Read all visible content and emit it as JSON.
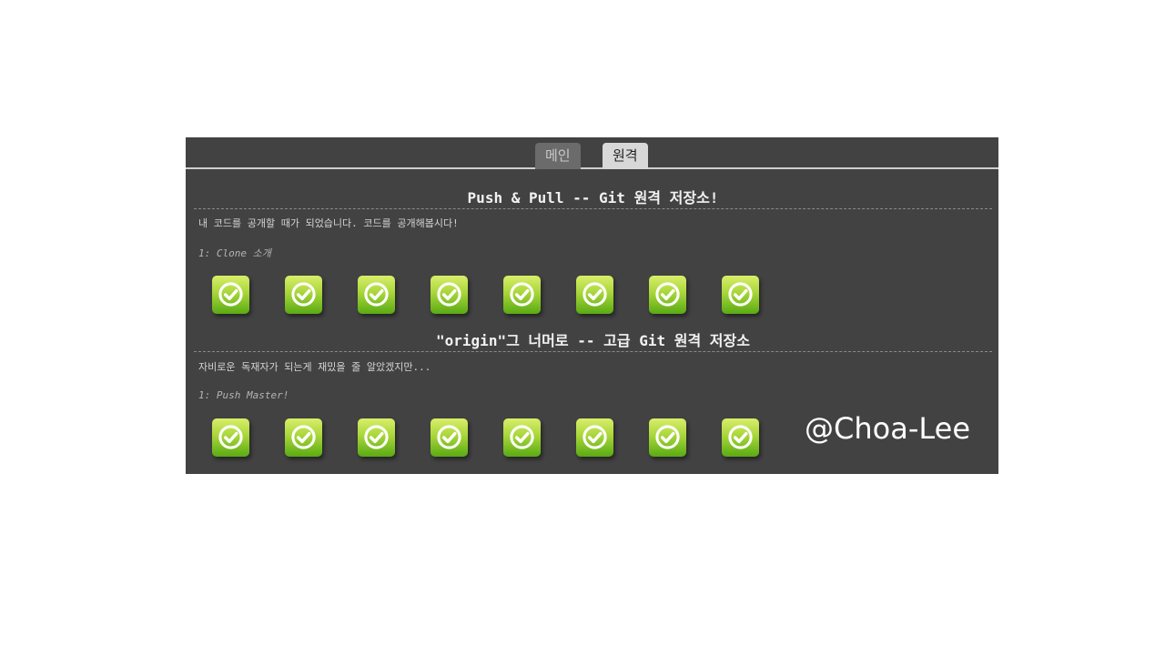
{
  "tabs": [
    {
      "label": "메인",
      "active": false
    },
    {
      "label": "원격",
      "active": true
    }
  ],
  "sections": [
    {
      "title": "Push & Pull -- Git 원격 저장소!",
      "description": "내 코드를 공개할 때가 되었습니다. 코드를 공개해봅시다!",
      "level_label": "1: Clone 소개",
      "levels_completed": 8
    },
    {
      "title": "\"origin\"그 너머로 -- 고급 Git 원격 저장소",
      "description": "자비로운 독재자가 되는게 재밌을 줄 알았겠지만...",
      "level_label": "1: Push Master!",
      "levels_completed": 8
    }
  ],
  "watermark": "@Choa-Lee",
  "icons": {
    "level_button": "checkmark-circle-icon"
  },
  "colors": {
    "panel_bg": "#424242",
    "level_green": "#7cc22a",
    "active_tab": "#d8d8d8"
  }
}
